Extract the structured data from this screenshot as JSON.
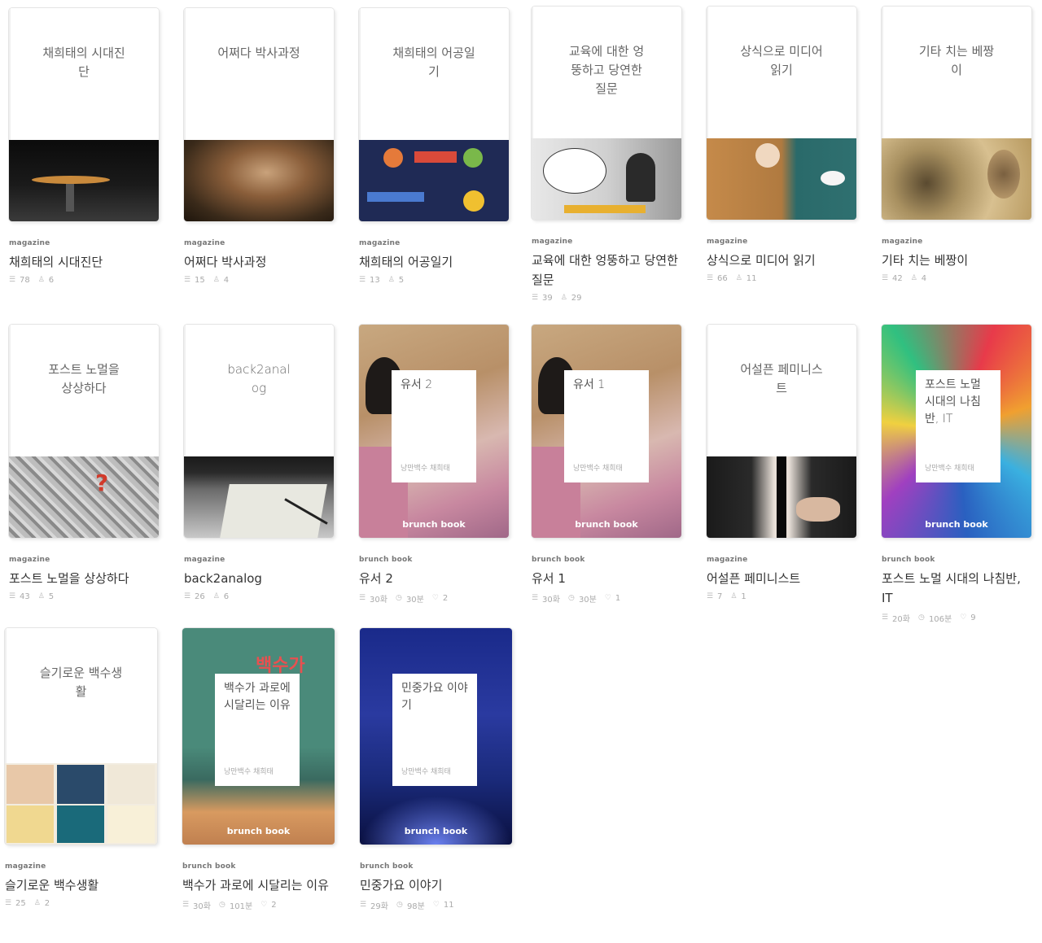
{
  "brand_label": "brunch book",
  "type_magazine": "magazine",
  "type_book": "brunch book",
  "author": "낭만백수 채희태",
  "cards": [
    {
      "kind": "magazine",
      "cover_title": "채희태의 시대진단",
      "title": "채희태의 시대진단",
      "count": "78",
      "subs": "6"
    },
    {
      "kind": "magazine",
      "cover_title": "어쩌다 박사과정",
      "title": "어쩌다 박사과정",
      "count": "15",
      "subs": "4"
    },
    {
      "kind": "magazine",
      "cover_title": "채희태의 어공일기",
      "title": "채희태의 어공일기",
      "count": "13",
      "subs": "5"
    },
    {
      "kind": "magazine",
      "cover_title": "교육에 대한 엉뚱하고 당연한 질문",
      "title": "교육에 대한 엉뚱하고 당연한 질문",
      "count": "39",
      "subs": "29"
    },
    {
      "kind": "magazine",
      "cover_title": "상식으로 미디어 읽기",
      "title": "상식으로 미디어 읽기",
      "count": "66",
      "subs": "11"
    },
    {
      "kind": "magazine",
      "cover_title": "기타 치는 베짱이",
      "title": "기타 치는 베짱이",
      "count": "42",
      "subs": "4"
    },
    {
      "kind": "magazine",
      "cover_title": "포스트 노멀을 상상하다",
      "title": "포스트 노멀을 상상하다",
      "count": "43",
      "subs": "5"
    },
    {
      "kind": "magazine",
      "cover_title": "back2analog",
      "title": "back2analog",
      "count": "26",
      "subs": "6"
    },
    {
      "kind": "book",
      "cover_title": "유서 2",
      "title": "유서 2",
      "count": "30화",
      "time": "30분",
      "likes": "2"
    },
    {
      "kind": "book",
      "cover_title": "유서 1",
      "title": "유서 1",
      "count": "30화",
      "time": "30분",
      "likes": "1"
    },
    {
      "kind": "magazine",
      "cover_title": "어설픈 페미니스트",
      "title": "어설픈 페미니스트",
      "count": "7",
      "subs": "1"
    },
    {
      "kind": "book",
      "cover_title": "포스트 노멀 시대의 나침반, IT",
      "title": "포스트 노멀 시대의 나침반, IT",
      "count": "20화",
      "time": "106분",
      "likes": "9"
    },
    {
      "kind": "magazine",
      "cover_title": "슬기로운 백수생활",
      "title": "슬기로운 백수생활",
      "count": "25",
      "subs": "2"
    },
    {
      "kind": "book",
      "cover_title": "백수가 과로에 시달리는 이유",
      "title": "백수가 과로에 시달리는 이유",
      "count": "30화",
      "time": "101분",
      "likes": "2"
    },
    {
      "kind": "book",
      "cover_title": "민중가요 이야기",
      "title": "민중가요 이야기",
      "count": "29화",
      "time": "98분",
      "likes": "11"
    }
  ],
  "icons": {
    "episodes": "list-icon",
    "subscribers": "person-icon",
    "time": "clock-icon",
    "likes": "heart-icon"
  }
}
